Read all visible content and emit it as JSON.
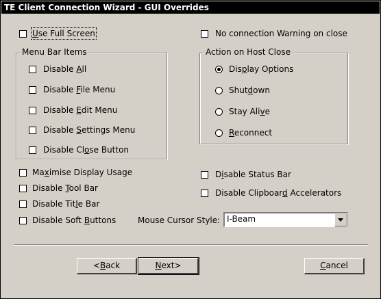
{
  "window": {
    "title": "TE Client Connection Wizard - GUI Overrides"
  },
  "options": {
    "use_full_screen": "Use Full Screen",
    "no_connection_warning": "No connection Warning on close",
    "maximise_display_usage": "Maximise Display Usage",
    "disable_tool_bar": "Disable Tool Bar",
    "disable_title_bar": "Disable Title Bar",
    "disable_soft_buttons": "Disable Soft Buttons",
    "disable_status_bar": "Disable Status Bar",
    "disable_clipboard_accelerators": "Disable Clipboard Accelerators"
  },
  "menu_bar": {
    "legend": "Menu Bar Items",
    "items": [
      "Disable All",
      "Disable File Menu",
      "Disable Edit Menu",
      "Disable Settings Menu",
      "Disable Close Button"
    ]
  },
  "host_close": {
    "legend": "Action on Host Close",
    "items": [
      "Display Options",
      "Shutdown",
      "Stay Alive",
      "Reconnect"
    ],
    "selected": "Display Options"
  },
  "cursor": {
    "label": "Mouse Cursor Style:",
    "value": "I-Beam"
  },
  "buttons": {
    "back": "<Back",
    "next": "Next>",
    "cancel": "Cancel"
  }
}
